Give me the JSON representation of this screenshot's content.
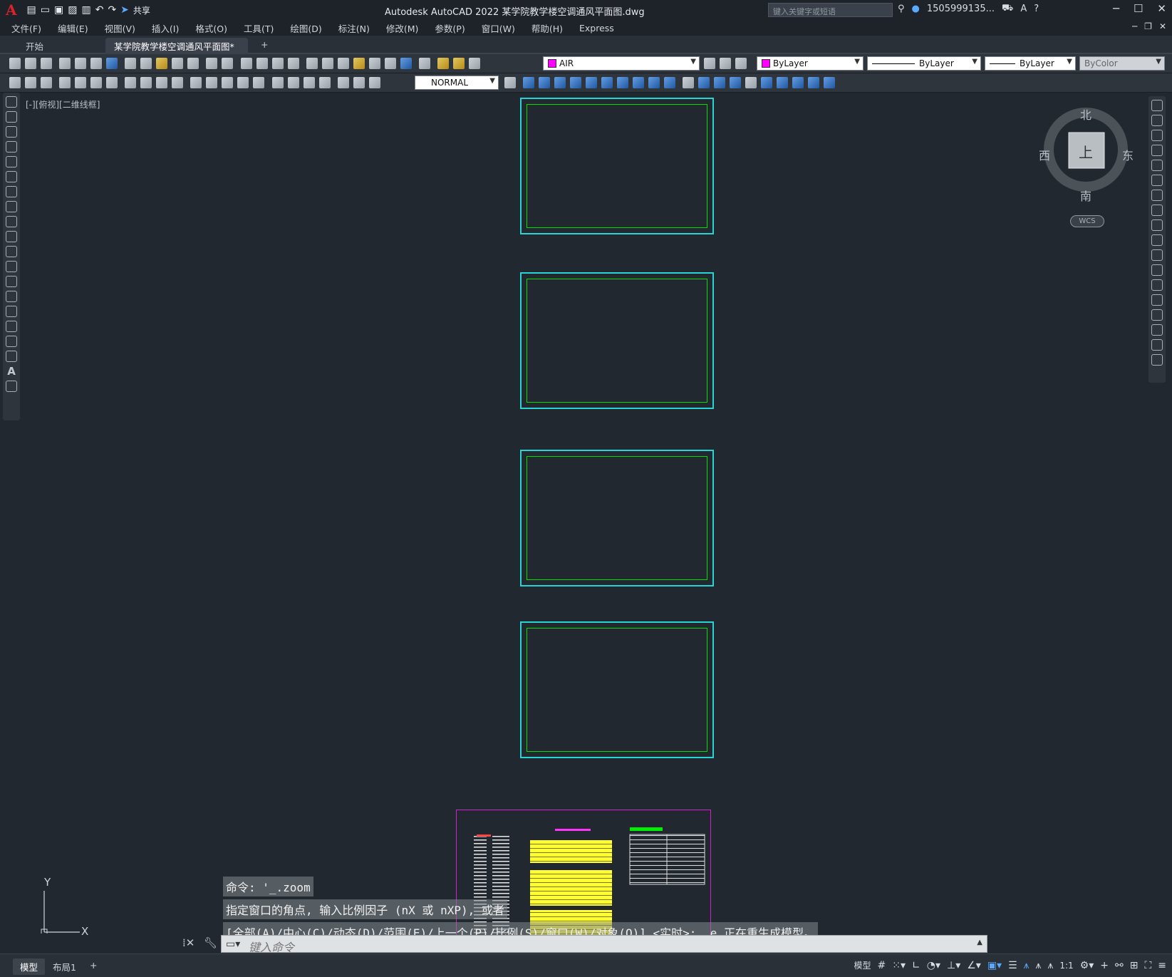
{
  "app": {
    "logo": "A",
    "share_label": "共享",
    "title": "Autodesk AutoCAD 2022    某学院教学楼空调通风平面图.dwg",
    "search_placeholder": "键入关键字或短语",
    "user": "1505999135...",
    "help": "?"
  },
  "menu": [
    "文件(F)",
    "编辑(E)",
    "视图(V)",
    "插入(I)",
    "格式(O)",
    "工具(T)",
    "绘图(D)",
    "标注(N)",
    "修改(M)",
    "参数(P)",
    "窗口(W)",
    "帮助(H)",
    "Express"
  ],
  "tabs": {
    "start": "开始",
    "file": "某学院教学楼空调通风平面图*",
    "close": "✕",
    "add": "+"
  },
  "properties": {
    "layer": "AIR",
    "color": "ByLayer",
    "linetype": "ByLayer",
    "lineweight": "ByLayer",
    "plotstyle": "ByColor",
    "text_style": "NORMAL"
  },
  "viewport": {
    "label": "[-][俯视][二维线框]"
  },
  "compass": {
    "north": "北",
    "south": "南",
    "east": "东",
    "west": "西",
    "top": "上",
    "wcs": "WCS"
  },
  "ucs": {
    "x": "X",
    "y": "Y"
  },
  "command": {
    "history": [
      "命令: '_.zoom",
      "指定窗口的角点, 输入比例因子 (nX 或 nXP), 或者",
      "[全部(A)/中心(C)/动态(D)/范围(E)/上一个(P)/比例(S)/窗口(W)/对象(O)] <实时>: _e 正在重生成模型。"
    ],
    "placeholder": "键入命令"
  },
  "status": {
    "model_tab": "模型",
    "layout_tab": "布局1",
    "add": "+",
    "model_btn": "模型",
    "scale": "1:1"
  },
  "colors": {
    "sheet_border": "#27d3d3",
    "drawing_green": "#00e000",
    "wall_blue": "#1c3cff",
    "legend_border": "#d020d0"
  }
}
